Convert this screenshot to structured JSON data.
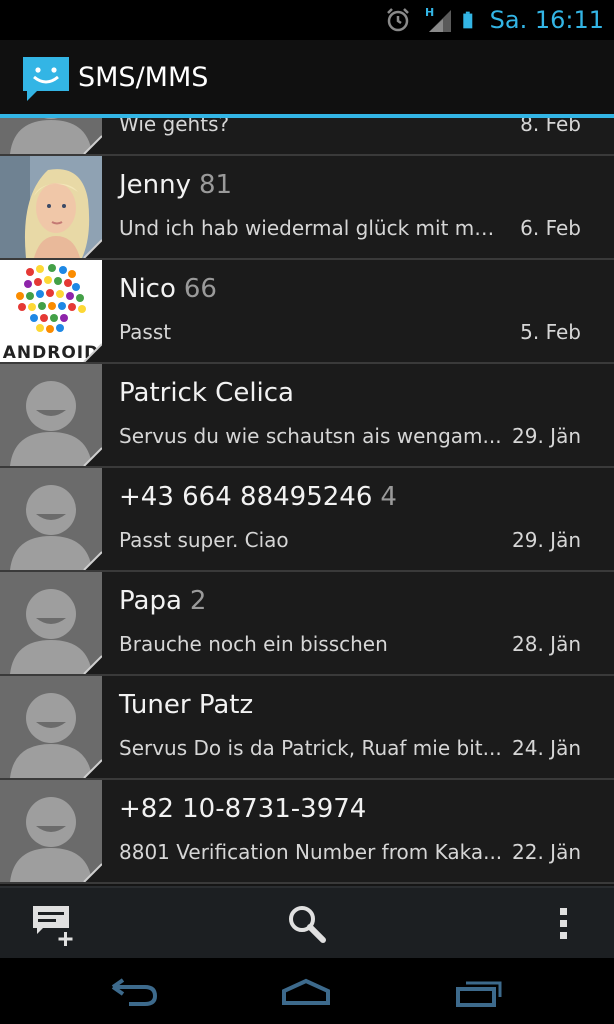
{
  "status_bar": {
    "time": "Sa. 16:11",
    "network_type": "H",
    "icons": [
      "alarm-clock-icon",
      "signal-icon",
      "battery-icon"
    ],
    "accent_color": "#33b5e5"
  },
  "action_bar": {
    "title": "SMS/MMS",
    "icon": "messaging-app-icon"
  },
  "conversations": [
    {
      "name": "",
      "count": "",
      "snippet": "Wie gehts?",
      "date": "8. Feb",
      "avatar": "default-contact"
    },
    {
      "name": "Jenny",
      "count": "81",
      "snippet": "Und ich hab wiedermal glück mit mei...",
      "date": "6. Feb",
      "avatar": "photo-blonde"
    },
    {
      "name": "Nico",
      "count": "66",
      "snippet": "Passt",
      "date": "5. Feb",
      "avatar": "android-logo"
    },
    {
      "name": "Patrick Celica",
      "count": "",
      "snippet": "Servus du wie schautsn ais wengam...",
      "date": "29. Jän",
      "avatar": "default-contact"
    },
    {
      "name": "+43 664 88495246",
      "count": "4",
      "snippet": "Passt super. Ciao",
      "date": "29. Jän",
      "avatar": "default-contact"
    },
    {
      "name": "Papa",
      "count": "2",
      "snippet": "Brauche noch ein bisschen",
      "date": "28. Jän",
      "avatar": "default-contact"
    },
    {
      "name": "Tuner Patz",
      "count": "",
      "snippet": "Servus Do is da Patrick, Ruaf mie bit...",
      "date": "24. Jän",
      "avatar": "default-contact"
    },
    {
      "name": "+82 10-8731-3974",
      "count": "",
      "snippet": "8801 Verification Number from Kaka...",
      "date": "22. Jän",
      "avatar": "default-contact"
    }
  ],
  "android_logo_text": "ANDROID",
  "bottom_actions": [
    {
      "icon": "new-message-icon"
    },
    {
      "icon": "search-icon"
    },
    {
      "icon": "overflow-menu-icon"
    }
  ],
  "nav_buttons": [
    {
      "icon": "back-icon"
    },
    {
      "icon": "home-icon"
    },
    {
      "icon": "recent-apps-icon"
    }
  ]
}
